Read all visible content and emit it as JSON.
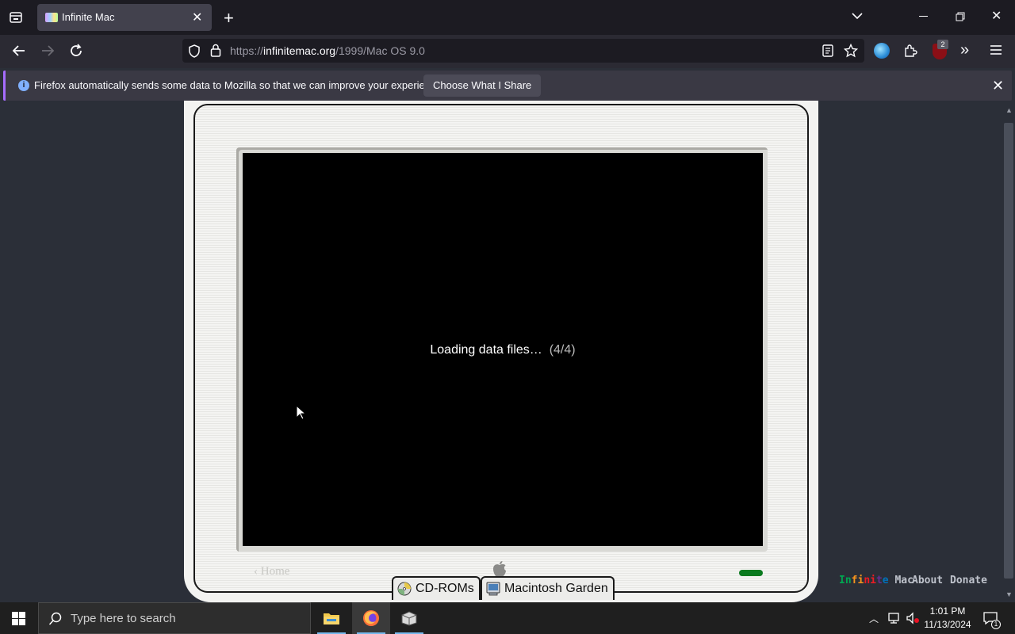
{
  "browser": {
    "tab_title": "Infinite Mac",
    "url_prefix": "https://",
    "url_host": "infinitemac.org",
    "url_path": "/1999/Mac OS 9.0",
    "extension_badge": "2"
  },
  "notification": {
    "text": "Firefox automatically sends some data to Mozilla so that we can improve your experience.",
    "button": "Choose What I Share"
  },
  "emulator": {
    "loading_text": "Loading data files…",
    "loading_count": "(4/4)",
    "home_link": "‹ Home",
    "cdroms_label": "CD-ROMs",
    "garden_label": "Macintosh Garden"
  },
  "footer": {
    "brand_letters": [
      "I",
      "n",
      "f",
      "i",
      "n",
      "i",
      "t",
      "e"
    ],
    "brand_colors": [
      "#00a651",
      "#00a651",
      "#f7941d",
      "#f7941d",
      "#ed1c24",
      "#ed1c24",
      "#662d91",
      "#0072bc"
    ],
    "brand_mac": "Mac",
    "about": "About",
    "donate": "Donate"
  },
  "taskbar": {
    "search_placeholder": "Type here to search",
    "time": "1:01 PM",
    "date": "11/13/2024",
    "notification_count": "1"
  }
}
